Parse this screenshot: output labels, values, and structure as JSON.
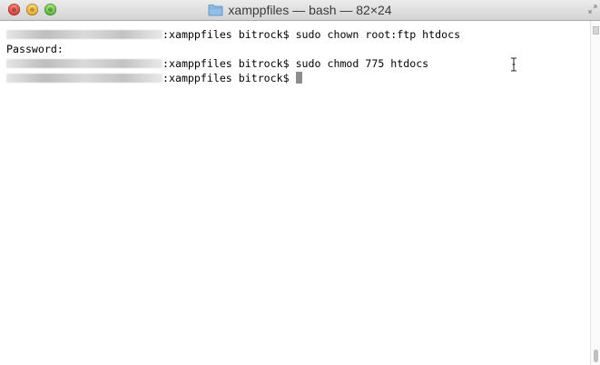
{
  "window": {
    "title": "xamppfiles — bash — 82×24"
  },
  "terminal": {
    "lines": [
      {
        "text": ":xamppfiles bitrock$ sudo chown root:ftp htdocs"
      },
      {
        "text": "Password:"
      },
      {
        "text": ":xamppfiles bitrock$ sudo chmod 775 htdocs"
      },
      {
        "text": ":xamppfiles bitrock$ "
      }
    ]
  },
  "colors": {
    "background": "#ffffff",
    "text": "#000000",
    "cursor": "#8c8c8c",
    "close": "#e0443c",
    "minimize": "#e9b12a",
    "zoom": "#5fbf3a"
  }
}
